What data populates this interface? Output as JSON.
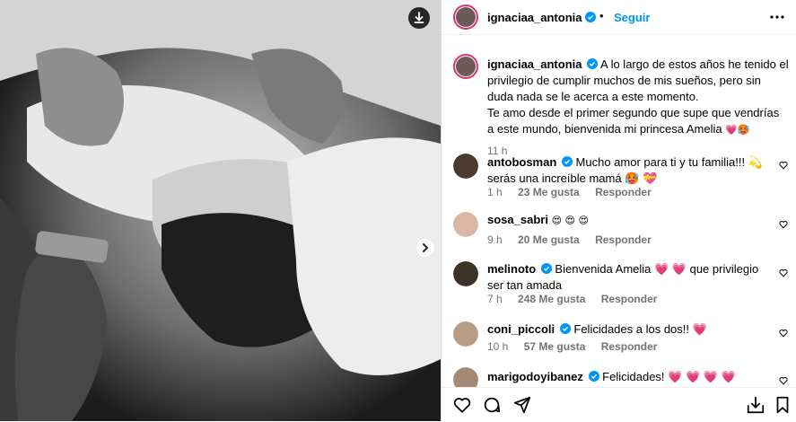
{
  "post": {
    "author": "ignaciaa_antonia",
    "follow_label": "Seguir",
    "more_icon": "more-horizontal-icon",
    "download_icon": "download-icon",
    "next_icon": "chevron-right-icon"
  },
  "caption": {
    "username": "ignaciaa_antonia",
    "text_line1": "A lo largo de estos años he tenido el privilegio de cumplir muchos de mis sueños, pero sin duda nada se le acerca a este momento.",
    "text_line2": "Te amo desde el primer segundo que supe que vendrías a este mundo, bienvenida mi princesa Amelia",
    "emojis": "💗🥵",
    "time": "11 h"
  },
  "comments": [
    {
      "username": "antobosman",
      "text": "Mucho amor para ti y tu familia!!! 💫 serás una increíble mamá 🥵 💝",
      "time": "1 h",
      "likes": "23 Me gusta",
      "reply": "Responder"
    },
    {
      "username": "sosa_sabri",
      "text": "😍 😍 😍",
      "time": "9 h",
      "likes": "20 Me gusta",
      "reply": "Responder"
    },
    {
      "username": "melinoto",
      "text": "Bienvenida Amelia 💗 💗 que privilegio ser tan amada",
      "time": "7 h",
      "likes": "248 Me gusta",
      "reply": "Responder"
    },
    {
      "username": "coni_piccoli",
      "text": "Felicidades a los dos!! 💗",
      "time": "10 h",
      "likes": "57 Me gusta",
      "reply": "Responder"
    },
    {
      "username": "marigodoyibanez",
      "text": "Felicidades! 💗 💗 💗 💗",
      "time": "",
      "likes": "",
      "reply": ""
    }
  ],
  "colors": {
    "link": "#0095f6",
    "verified": "#0095f6",
    "muted": "#737373"
  }
}
